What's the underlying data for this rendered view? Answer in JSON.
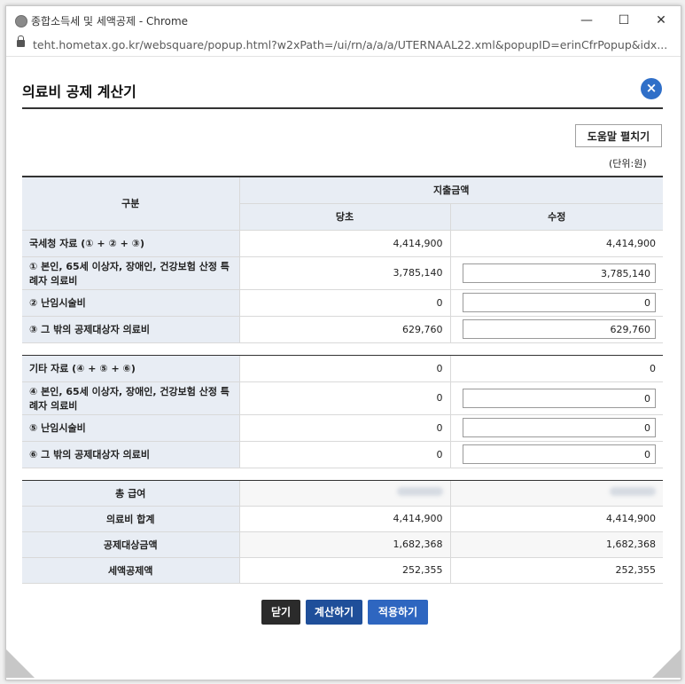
{
  "window": {
    "title": "종합소득세 및 세액공제 - Chrome",
    "minimize": "—",
    "maximize": "☐",
    "close": "✕"
  },
  "address": {
    "url": "teht.hometax.go.kr/websquare/popup.html?w2xPath=/ui/rn/a/a/a/UTERNAAL22.xml&popupID=erinCfrPopup&idx..."
  },
  "dialog": {
    "title": "의료비 공제 계산기",
    "close_icon": "×",
    "help_label": "도움말 펼치기",
    "unit_label": "(단위:원)"
  },
  "table": {
    "col_category": "구분",
    "col_expense": "지출금액",
    "col_original": "당초",
    "col_revised": "수정",
    "nts": {
      "total": {
        "label": "국세청 자료 (① + ② + ③)",
        "original": "4,414,900",
        "revised": "4,414,900"
      },
      "row1": {
        "label": "① 본인, 65세 이상자, 장애인, 건강보험 산정 특례자 의료비",
        "original": "3,785,140",
        "revised": "3,785,140"
      },
      "row2": {
        "label": "② 난임시술비",
        "original": "0",
        "revised": "0"
      },
      "row3": {
        "label": "③ 그 밖의 공제대상자 의료비",
        "original": "629,760",
        "revised": "629,760"
      }
    },
    "other": {
      "total": {
        "label": "기타 자료 (④ + ⑤ + ⑥)",
        "original": "0",
        "revised": "0"
      },
      "row4": {
        "label": "④ 본인, 65세 이상자, 장애인, 건강보험 산정 특례자 의료비",
        "original": "0",
        "revised": "0"
      },
      "row5": {
        "label": "⑤ 난임시술비",
        "original": "0",
        "revised": "0"
      },
      "row6": {
        "label": "⑥ 그 밖의 공제대상자 의료비",
        "original": "0",
        "revised": "0"
      }
    },
    "summary": {
      "salary": {
        "label": "총 급여"
      },
      "medical_total": {
        "label": "의료비 합계",
        "original": "4,414,900",
        "revised": "4,414,900"
      },
      "deductible": {
        "label": "공제대상금액",
        "original": "1,682,368",
        "revised": "1,682,368"
      },
      "tax_credit": {
        "label": "세액공제액",
        "original": "252,355",
        "revised": "252,355"
      }
    }
  },
  "buttons": {
    "close": "닫기",
    "calculate": "계산하기",
    "apply": "적용하기"
  }
}
